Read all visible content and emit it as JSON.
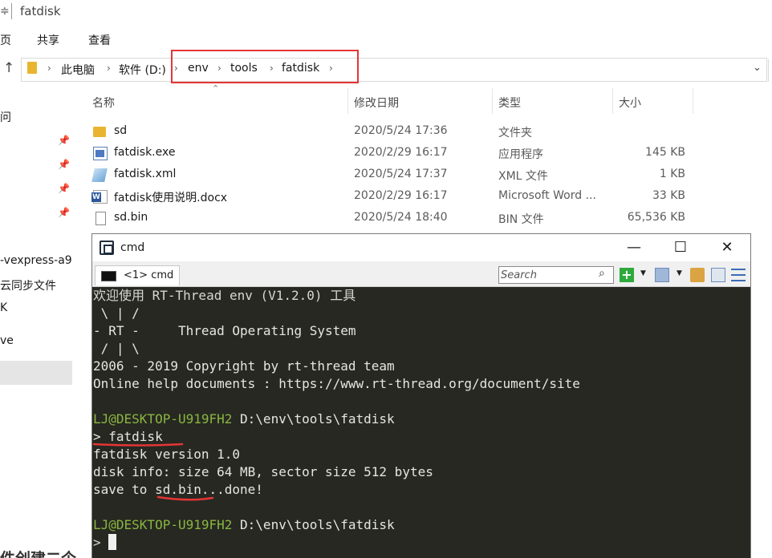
{
  "explorer": {
    "title_prefix": "≑",
    "window_title": "fatdisk",
    "ribbon": [
      "页",
      "共享",
      "查看"
    ],
    "breadcrumb": [
      "此电脑",
      "软件 (D:)",
      "env",
      "tools",
      "fatdisk"
    ],
    "columns": {
      "name": "名称",
      "date": "修改日期",
      "type": "类型",
      "size": "大小"
    },
    "files": [
      {
        "name": "sd",
        "date": "2020/5/24 17:36",
        "type": "文件夹",
        "size": "",
        "icon": "folder-icon"
      },
      {
        "name": "fatdisk.exe",
        "date": "2020/2/29 16:17",
        "type": "应用程序",
        "size": "145 KB",
        "icon": "exe-icon"
      },
      {
        "name": "fatdisk.xml",
        "date": "2020/5/24 17:37",
        "type": "XML 文件",
        "size": "1 KB",
        "icon": "xml-icon"
      },
      {
        "name": "fatdisk使用说明.docx",
        "date": "2020/2/29 16:17",
        "type": "Microsoft Word ...",
        "size": "33 KB",
        "icon": "word-icon"
      },
      {
        "name": "sd.bin",
        "date": "2020/5/24 18:40",
        "type": "BIN 文件",
        "size": "65,536 KB",
        "icon": "bin-icon"
      }
    ],
    "nav_items": [
      "问",
      "-vexpress-a9",
      "云同步文件",
      "K",
      "ve"
    ],
    "bottom_text": "件创建二个"
  },
  "cmd": {
    "title": "cmd",
    "tab_label": "<1> cmd",
    "search_placeholder": "Search",
    "console_lines": [
      "欢迎使用 RT-Thread env (V1.2.0) 工具",
      " \\ | /",
      "- RT -     Thread Operating System",
      " / | \\",
      "2006 - 2019 Copyright by rt-thread team",
      "Online help documents : https://www.rt-thread.org/document/site",
      "",
      "",
      "> fatdisk",
      "fatdisk version 1.0",
      "disk info: size 64 MB, sector size 512 bytes",
      "save to sd.bin...done!",
      "",
      "",
      ">"
    ],
    "prompt_user": "LJ@DESKTOP-U919FH2",
    "prompt_path": "D:\\env\\tools\\fatdisk"
  },
  "colors": {
    "highlight": "#e53535",
    "console_bg": "#272822",
    "prompt_green": "#8ab640"
  }
}
